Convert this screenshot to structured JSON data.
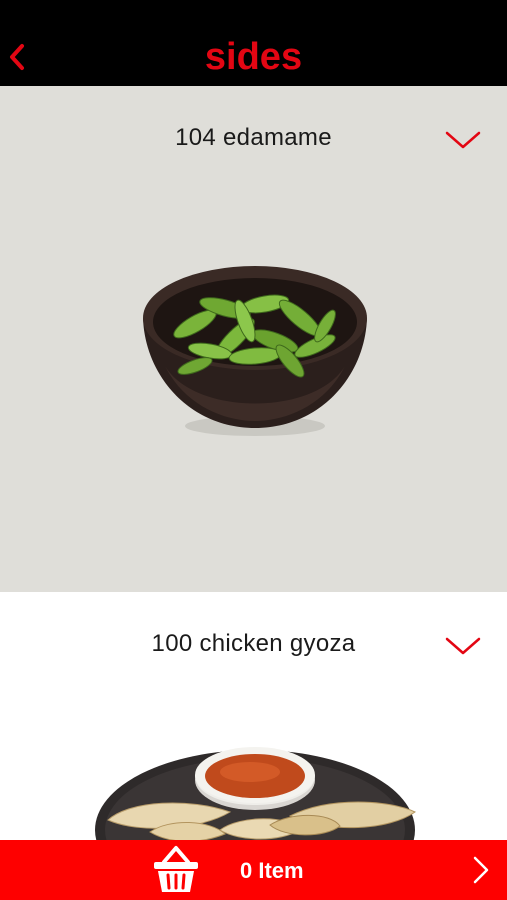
{
  "header": {
    "title": "sides",
    "back_icon": "chevron-left-icon"
  },
  "items": [
    {
      "name": "104 edamame",
      "expand_icon": "chevron-down-icon",
      "image": "edamame-bowl"
    },
    {
      "name": "100 chicken gyoza",
      "expand_icon": "chevron-down-icon",
      "image": "gyoza-plate"
    }
  ],
  "cart": {
    "count_label": "0 Item",
    "basket_icon": "basket-icon",
    "next_icon": "chevron-right-icon"
  },
  "colors": {
    "accent": "#e30613",
    "header_bg": "#000000",
    "cart_bg": "#fe0000",
    "card_bg": "#dfded9"
  }
}
